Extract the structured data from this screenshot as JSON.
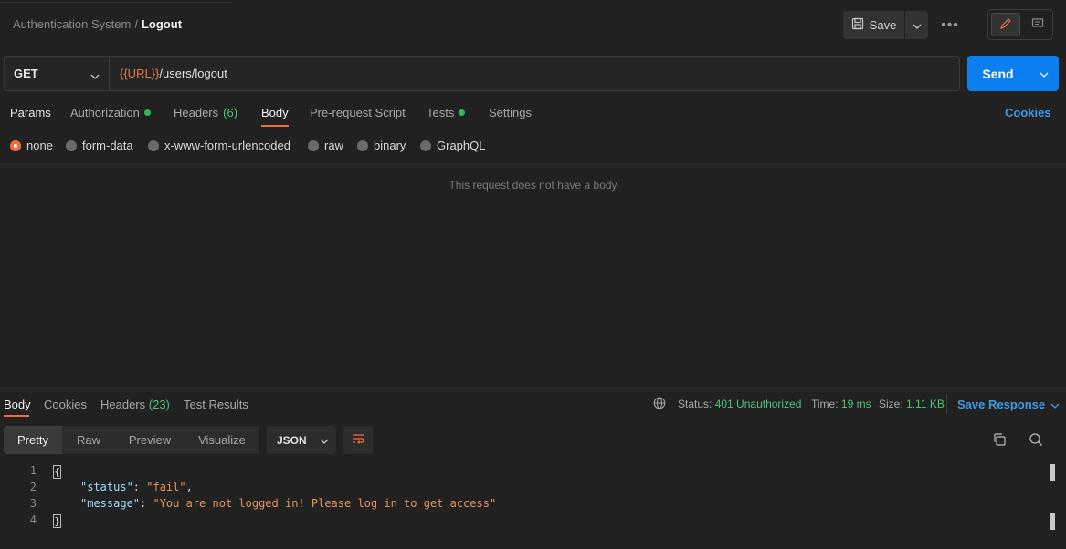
{
  "header": {
    "collection": "Authentication System",
    "separator": "/",
    "request_name": "Logout",
    "save_label": "Save",
    "more_label": "•••"
  },
  "request": {
    "method": "GET",
    "url_var": "{{URL}}",
    "url_path": "/users/logout",
    "send_label": "Send"
  },
  "request_tabs": {
    "params": "Params",
    "authorization": "Authorization",
    "headers": "Headers",
    "headers_count": "(6)",
    "body": "Body",
    "pre_request": "Pre-request Script",
    "tests": "Tests",
    "settings": "Settings",
    "cookies": "Cookies"
  },
  "body_types": {
    "none": "none",
    "form_data": "form-data",
    "urlencoded": "x-www-form-urlencoded",
    "raw": "raw",
    "binary": "binary",
    "graphql": "GraphQL"
  },
  "body_empty_message": "This request does not have a body",
  "response_tabs": {
    "body": "Body",
    "cookies": "Cookies",
    "headers": "Headers",
    "headers_count": "(23)",
    "test_results": "Test Results"
  },
  "response_meta": {
    "status_label": "Status:",
    "status_value": "401 Unauthorized",
    "time_label": "Time:",
    "time_value": "19 ms",
    "size_label": "Size:",
    "size_value": "1.11 KB",
    "save_response": "Save Response"
  },
  "view_modes": {
    "pretty": "Pretty",
    "raw": "Raw",
    "preview": "Preview",
    "visualize": "Visualize",
    "format": "JSON"
  },
  "code": {
    "line_numbers": [
      "1",
      "2",
      "3",
      "4"
    ],
    "open_brace": "{",
    "close_brace": "}",
    "key1": "\"status\"",
    "val1": "\"fail\"",
    "key2": "\"message\"",
    "val2": "\"You are not logged in! Please log in to get access\"",
    "colon": ": ",
    "comma": ","
  },
  "colors": {
    "accent": "#f26b3a",
    "send": "#0b7ef0",
    "success": "#4fc37a",
    "link": "#3d9be9"
  }
}
